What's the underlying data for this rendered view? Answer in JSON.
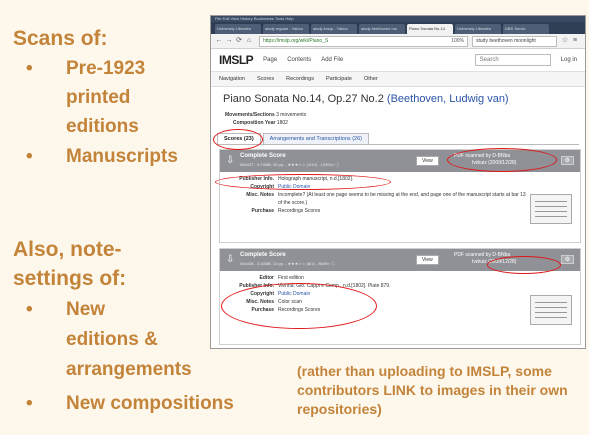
{
  "left_text": {
    "heading1": "Scans of:",
    "bullets1": [
      "Pre-1923 printed editions",
      "Manuscripts"
    ],
    "heading2a": "Also, note-",
    "heading2b": "settings of:",
    "bullets2": [
      "New editions &",
      "arrangements",
      "New compositions"
    ],
    "bullet_glyph": "•",
    "line_pre1923": "Pre-1923",
    "line_printed": "printed",
    "line_editions": "editions",
    "line_new": "New",
    "line_editions_amp": "editions &"
  },
  "note": "(rather than uploading to IMSLP, some contributors LINK to images in their own repositories)",
  "browser": {
    "menubar": "File  Edit  View  History  Bookmarks  Tools  Help",
    "tabs": [
      "University Libraries",
      "study regular - Yahoo",
      "study imslp - Yahoo",
      "study beethoven mo",
      "Piano Sonata No.14",
      "University Libraries",
      "DBS Servic"
    ],
    "active_tab": 4,
    "url": "https://imslp.org/wiki/Piano_S",
    "zoom": "100%",
    "search": "study beethoven moonlight"
  },
  "imslp": {
    "logo": "IMSLP",
    "page_btn": "Page",
    "contents_btn": "Contents",
    "addfile_btn": "Add File",
    "search_placeholder": "Search",
    "login": "Log in",
    "nav": [
      "Navigation",
      "Scores",
      "Recordings",
      "Participate",
      "Other"
    ],
    "title": "Piano Sonata No.14, Op.27 No.2",
    "composer": "(Beethoven, Ludwig van)",
    "mov_label": "Movements/Sections",
    "mov_value": "3 movements",
    "year_label": "Composition Year",
    "year_value": "1802",
    "tab_scores": "Scores (23)",
    "tab_arr": "Arrangements and Transcriptions (26)"
  },
  "cards": [
    {
      "title": "Complete Score",
      "sub": "#54437 - 4.74MB, 32 pp. - ★★★☆☆ (1/10) - 12993× ⓘ",
      "view": "View",
      "pdf_line1": "PDF scanned by D-BNba",
      "pdf_line2": "Ivdruiz (2009/12/28)",
      "rows": [
        {
          "label": "Publisher Info.",
          "value": "Holograph manuscript, n.d.[1802]."
        },
        {
          "label": "Copyright",
          "value": "Public Domain"
        },
        {
          "label": "Misc. Notes",
          "value": "Incomplete? (At least one page seems to be missing at the end, and page one of the manuscript starts at bar 13 of the score.)"
        },
        {
          "label": "Purchase",
          "value": "Recordings    Scores"
        }
      ]
    },
    {
      "title": "Complete Score",
      "sub": "#54438 - 3.34MB, 13 pp. - ★★★☆☆ (8/1) - 8649× ⓘ",
      "view": "View",
      "pdf_line1": "PDF scanned by D-BNba",
      "pdf_line2": "Ivdruiz (2009/12/28)",
      "rows": [
        {
          "label": "Editor",
          "value": "First edition"
        },
        {
          "label": "Publisher Info.",
          "value": "Vienna: Gio. Cappi e Comp., n.d.[1802]. Plate 879."
        },
        {
          "label": "Copyright",
          "value": "Public Domain"
        },
        {
          "label": "Misc. Notes",
          "value": "Color scan"
        },
        {
          "label": "Purchase",
          "value": "Recordings    Scores"
        }
      ]
    }
  ],
  "colors": {
    "accent_text": "#c3843a",
    "annotation_circle": "#e01818",
    "imslp_link": "#2b55a8"
  }
}
